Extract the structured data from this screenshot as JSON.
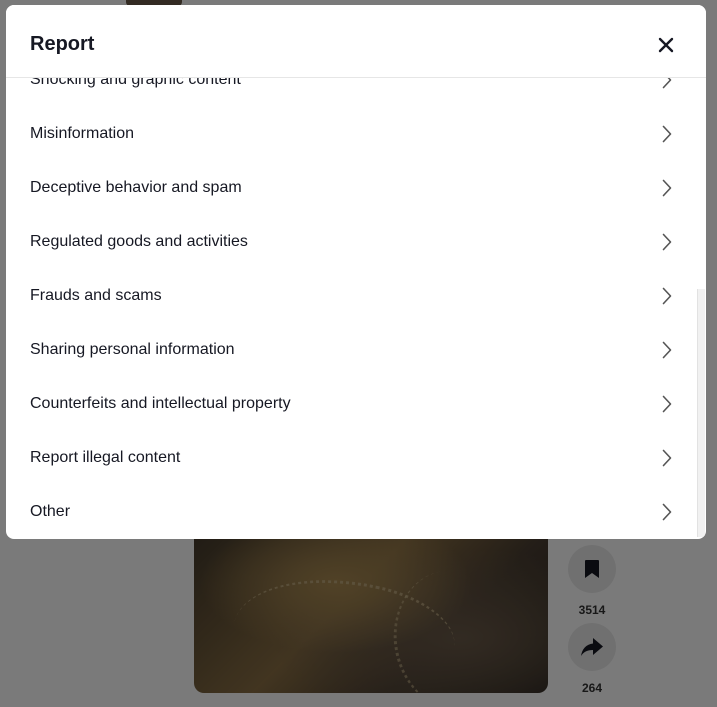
{
  "modal": {
    "title": "Report",
    "close_icon": "close-icon",
    "items": [
      {
        "label": "Shocking and graphic content"
      },
      {
        "label": "Misinformation"
      },
      {
        "label": "Deceptive behavior and spam"
      },
      {
        "label": "Regulated goods and activities"
      },
      {
        "label": "Frauds and scams"
      },
      {
        "label": "Sharing personal information"
      },
      {
        "label": "Counterfeits and intellectual property"
      },
      {
        "label": "Report illegal content"
      },
      {
        "label": "Other"
      }
    ]
  },
  "background": {
    "actions": [
      {
        "icon": "bookmark-icon",
        "count": "3514"
      },
      {
        "icon": "share-icon",
        "count": "264"
      }
    ]
  },
  "colors": {
    "text": "#161823",
    "overlay": "rgba(0,0,0,0.52)",
    "divider": "#e6e6e6"
  }
}
